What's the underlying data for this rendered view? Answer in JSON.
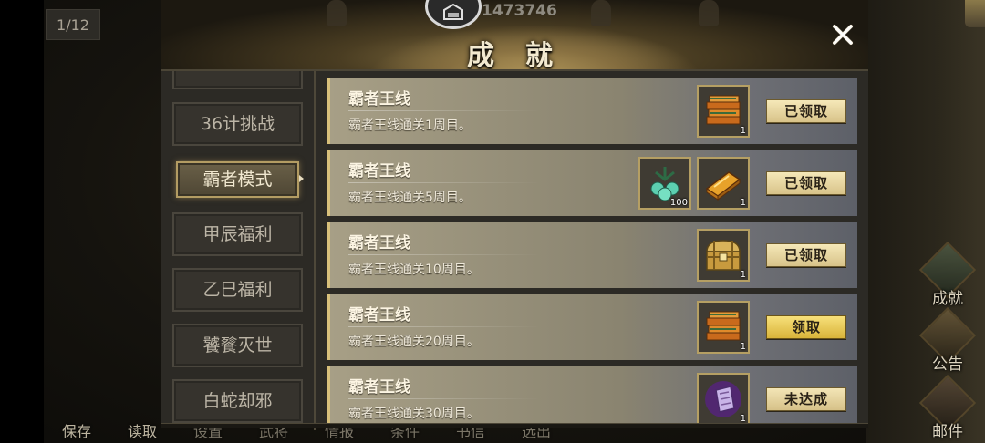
{
  "hud": {
    "page_counter": "1/12",
    "score": "1473746",
    "side_buttons": [
      {
        "label": "成就",
        "icon": "achievement-icon"
      },
      {
        "label": "公告",
        "icon": "horn-icon"
      },
      {
        "label": "邮件",
        "icon": "mail-icon"
      }
    ],
    "bottom_menu": [
      "保存",
      "读取",
      "设置",
      "武将",
      "情报",
      "条件",
      "书信",
      "选出"
    ]
  },
  "dialog": {
    "title": "成就",
    "close_icon": "close-x-icon"
  },
  "tabs": [
    {
      "label": "36计挑战",
      "active": false
    },
    {
      "label": "霸者模式",
      "active": true
    },
    {
      "label": "甲辰福利",
      "active": false
    },
    {
      "label": "乙巳福利",
      "active": false
    },
    {
      "label": "饕餮灭世",
      "active": false
    },
    {
      "label": "白蛇却邪",
      "active": false
    }
  ],
  "achievements": [
    {
      "title": "霸者王线",
      "desc": "霸者王线通关1周目。",
      "rewards": [
        {
          "icon": "book-stack-icon",
          "count": "1"
        }
      ],
      "button": "已领取",
      "state": "claimed"
    },
    {
      "title": "霸者王线",
      "desc": "霸者王线通关5周目。",
      "rewards": [
        {
          "icon": "jade-pendant-icon",
          "count": "100"
        },
        {
          "icon": "scroll-book-icon",
          "count": "1"
        }
      ],
      "button": "已领取",
      "state": "claimed"
    },
    {
      "title": "霸者王线",
      "desc": "霸者王线通关10周目。",
      "rewards": [
        {
          "icon": "treasure-chest-icon",
          "count": "1"
        }
      ],
      "button": "已领取",
      "state": "claimed"
    },
    {
      "title": "霸者王线",
      "desc": "霸者王线通关20周目。",
      "rewards": [
        {
          "icon": "book-stack-icon",
          "count": "1"
        }
      ],
      "button": "领取",
      "state": "available"
    },
    {
      "title": "霸者王线",
      "desc": "霸者王线通关30周目。",
      "rewards": [
        {
          "icon": "purple-token-icon",
          "count": "1"
        }
      ],
      "button": "未达成",
      "state": "locked"
    }
  ],
  "colors": {
    "row_gold_edge": "#d8c07b",
    "button_claimed": "#e8d7a0",
    "button_available": "#e6c451",
    "tab_active_border": "#b39c63"
  }
}
